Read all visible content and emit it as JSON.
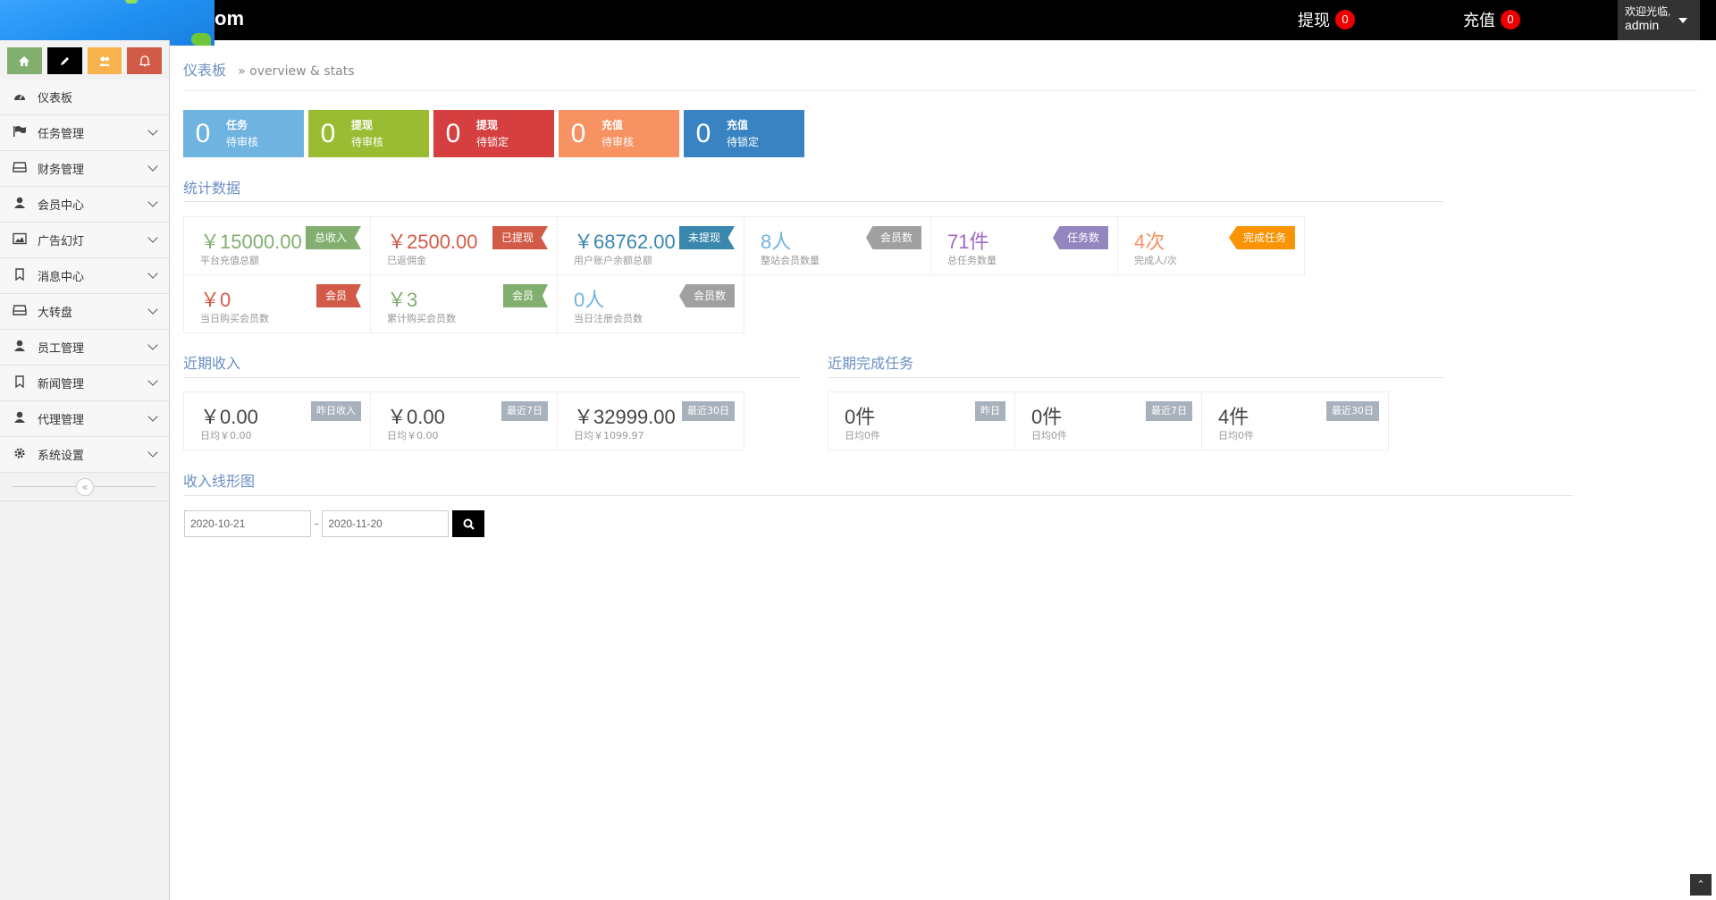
{
  "navbar": {
    "brand_tail": "om",
    "withdraw": {
      "label": "提现",
      "count": "0"
    },
    "recharge": {
      "label": "充值",
      "count": "0"
    },
    "user": {
      "greeting": "欢迎光临,",
      "name": "admin"
    }
  },
  "sidebar": {
    "items": [
      {
        "label": "仪表板",
        "icon": "dashboard-icon"
      },
      {
        "label": "任务管理",
        "icon": "flag-icon"
      },
      {
        "label": "财务管理",
        "icon": "inbox-icon"
      },
      {
        "label": "会员中心",
        "icon": "user-icon"
      },
      {
        "label": "广告幻灯",
        "icon": "picture-icon"
      },
      {
        "label": "消息中心",
        "icon": "bookmark-icon"
      },
      {
        "label": "大转盘",
        "icon": "inbox-icon"
      },
      {
        "label": "员工管理",
        "icon": "user-icon"
      },
      {
        "label": "新闻管理",
        "icon": "bookmark-icon"
      },
      {
        "label": "代理管理",
        "icon": "user-icon"
      },
      {
        "label": "系统设置",
        "icon": "gear-icon"
      }
    ]
  },
  "breadcrumb": {
    "title": "仪表板",
    "subtitle": "» overview & stats"
  },
  "infoboxes": [
    {
      "num": "0",
      "line1": "任务",
      "line2": "待审核",
      "color": "#6fb3e0"
    },
    {
      "num": "0",
      "line1": "提现",
      "line2": "待审核",
      "color": "#9abc32"
    },
    {
      "num": "0",
      "line1": "提现",
      "line2": "待锁定",
      "color": "#d53f40"
    },
    {
      "num": "0",
      "line1": "充值",
      "line2": "待审核",
      "color": "#f79263"
    },
    {
      "num": "0",
      "line1": "充值",
      "line2": "待锁定",
      "color": "#3983c2"
    }
  ],
  "stats": {
    "title": "统计数据",
    "cells": [
      {
        "value": "￥15000.00",
        "desc": "平台充值总额",
        "tag": "总收入",
        "color": "#82af6f"
      },
      {
        "value": "￥2500.00",
        "desc": "已返佣金",
        "tag": "已提现",
        "color": "#d15b47"
      },
      {
        "value": "￥68762.00",
        "desc": "用户账户余额总额",
        "tag": "未提现",
        "color": "#3a87ad"
      },
      {
        "value": "8人",
        "desc": "整站会员数量",
        "tag": "会员数",
        "color": "#6fb3e0",
        "tagcolor": "#a0a0a0"
      },
      {
        "value": "71件",
        "desc": "总任务数量",
        "tag": "任务数",
        "color": "#a069c3",
        "tagcolor": "#9585bf"
      },
      {
        "value": "4次",
        "desc": "完成人/次",
        "tag": "完成任务",
        "color": "#f79263",
        "tagcolor": "#f89406"
      },
      {
        "value": "￥0",
        "desc": "当日购买会员数",
        "tag": "会员",
        "color": "#d15b47"
      },
      {
        "value": "￥3",
        "desc": "累计购买会员数",
        "tag": "会员",
        "color": "#82af6f"
      },
      {
        "value": "0人",
        "desc": "当日注册会员数",
        "tag": "会员数",
        "color": "#6fb3e0",
        "tagcolor": "#a0a0a0"
      }
    ]
  },
  "income": {
    "title": "近期收入",
    "cells": [
      {
        "value": "￥0.00",
        "desc": "日均￥0.00",
        "tag": "昨日收入"
      },
      {
        "value": "￥0.00",
        "desc": "日均￥0.00",
        "tag": "最近7日"
      },
      {
        "value": "￥32999.00",
        "desc": "日均￥1099.97",
        "tag": "最近30日"
      }
    ]
  },
  "tasks": {
    "title": "近期完成任务",
    "cells": [
      {
        "value": "0件",
        "desc": "日均0件",
        "tag": "昨日"
      },
      {
        "value": "0件",
        "desc": "日均0件",
        "tag": "最近7日"
      },
      {
        "value": "4件",
        "desc": "日均0件",
        "tag": "最近30日"
      }
    ]
  },
  "chart_section": {
    "title": "收入线形图",
    "date_from": "2020-10-21",
    "date_to": "2020-11-20",
    "separator": "-"
  }
}
